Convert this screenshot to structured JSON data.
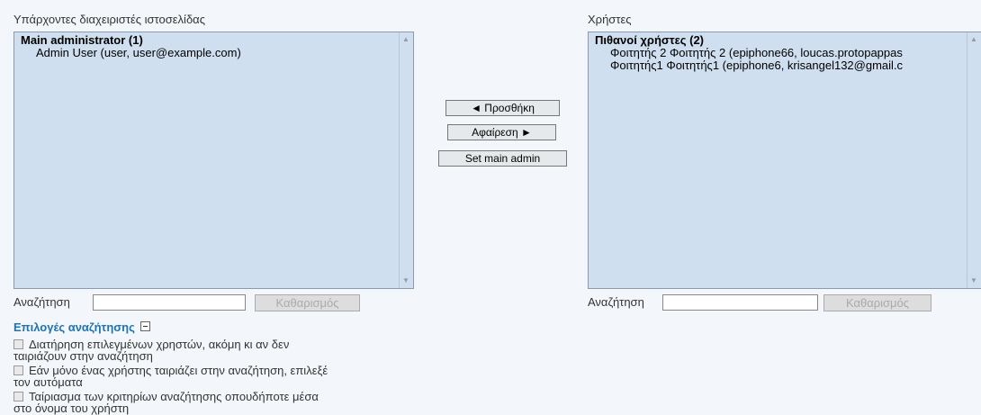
{
  "left": {
    "label": "Υπάρχοντες διαχειριστές ιστοσελίδας",
    "group": "Main administrator (1)",
    "options": [
      "Admin User (user, user@example.com)"
    ],
    "search_label": "Αναζήτηση",
    "search_value": "",
    "clear_label": "Καθαρισμός"
  },
  "right": {
    "label": "Χρήστες",
    "group": "Πιθανοί χρήστες (2)",
    "options": [
      "Φοιτητής 2 Φοιτητής 2 (epiphone66, loucas.protopappas",
      "Φοιτητής1 Φοιτητής1 (epiphone6, krisangel132@gmail.c"
    ],
    "search_label": "Αναζήτηση",
    "search_value": "",
    "clear_label": "Καθαρισμός"
  },
  "actions": {
    "add_label": "◄ Προσθήκη",
    "remove_label": "Αφαίρεση ►",
    "main_admin_label": "Set main admin"
  },
  "search_options": {
    "title": "Επιλογές αναζήτησης",
    "items": [
      {
        "line1": "Διατήρηση επιλεγμένων χρηστών, ακόμη κι αν δεν",
        "line2": "ταιριάζουν στην αναζήτηση",
        "checked": false
      },
      {
        "line1": "Εάν μόνο ένας χρήστης ταιριάζει στην αναζήτηση, επιλεξέ",
        "line2": "τον αυτόματα",
        "checked": false
      },
      {
        "line1": "Ταίριασμα των κριτηρίων αναζήτησης οπουδήποτε μέσα",
        "line2": "στο όνομα του χρήστη",
        "checked": false
      }
    ]
  }
}
